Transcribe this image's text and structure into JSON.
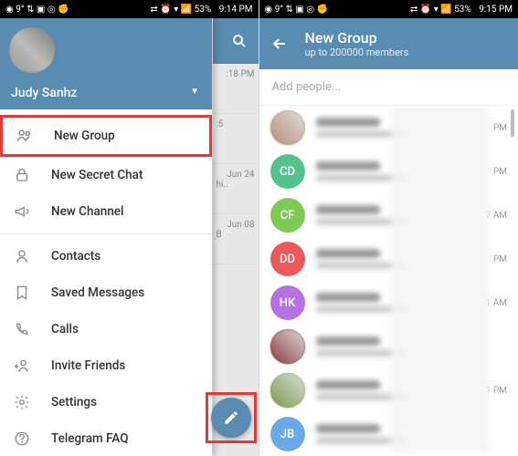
{
  "status": {
    "left_icons": "◉ 9° ⇅ ▣ ◎ ✊",
    "right_icons": "⇄ ⏰ ▾ 📶 53%",
    "time_left": "9:14 PM",
    "time_right": "9:15 PM"
  },
  "drawer": {
    "username": "Judy Sanhz",
    "items": [
      {
        "label": "New Group"
      },
      {
        "label": "New Secret Chat"
      },
      {
        "label": "New Channel"
      },
      {
        "label": "Contacts"
      },
      {
        "label": "Saved Messages"
      },
      {
        "label": "Calls"
      },
      {
        "label": "Invite Friends"
      },
      {
        "label": "Settings"
      },
      {
        "label": "Telegram FAQ"
      }
    ]
  },
  "bg_chats": [
    {
      "time": ":18 PM",
      "text": ""
    },
    {
      "time": "",
      "text": ":5"
    },
    {
      "time": "Jun 24",
      "text": "hi.."
    },
    {
      "time": "Jun 08",
      "text": "B"
    }
  ],
  "new_group": {
    "title": "New Group",
    "subtitle": "up to 200000 members",
    "search_placeholder": "Add people..."
  },
  "contacts": [
    {
      "initials": "",
      "color": "#b89078",
      "photo": true,
      "time": "PM"
    },
    {
      "initials": "CD",
      "color": "#55c28e",
      "time": "PM"
    },
    {
      "initials": "CF",
      "color": "#7fc955",
      "time": "7 AM"
    },
    {
      "initials": "DD",
      "color": "#ea5a5a",
      "time": "PM"
    },
    {
      "initials": "HK",
      "color": "#b571e0",
      "time": "1 AM"
    },
    {
      "initials": "",
      "color": "#8b3a3a",
      "photo": true,
      "time": ""
    },
    {
      "initials": "",
      "color": "#7a9a4a",
      "photo": true,
      "time": "1 PM"
    },
    {
      "initials": "JB",
      "color": "#6aa8e8",
      "time": ""
    }
  ]
}
